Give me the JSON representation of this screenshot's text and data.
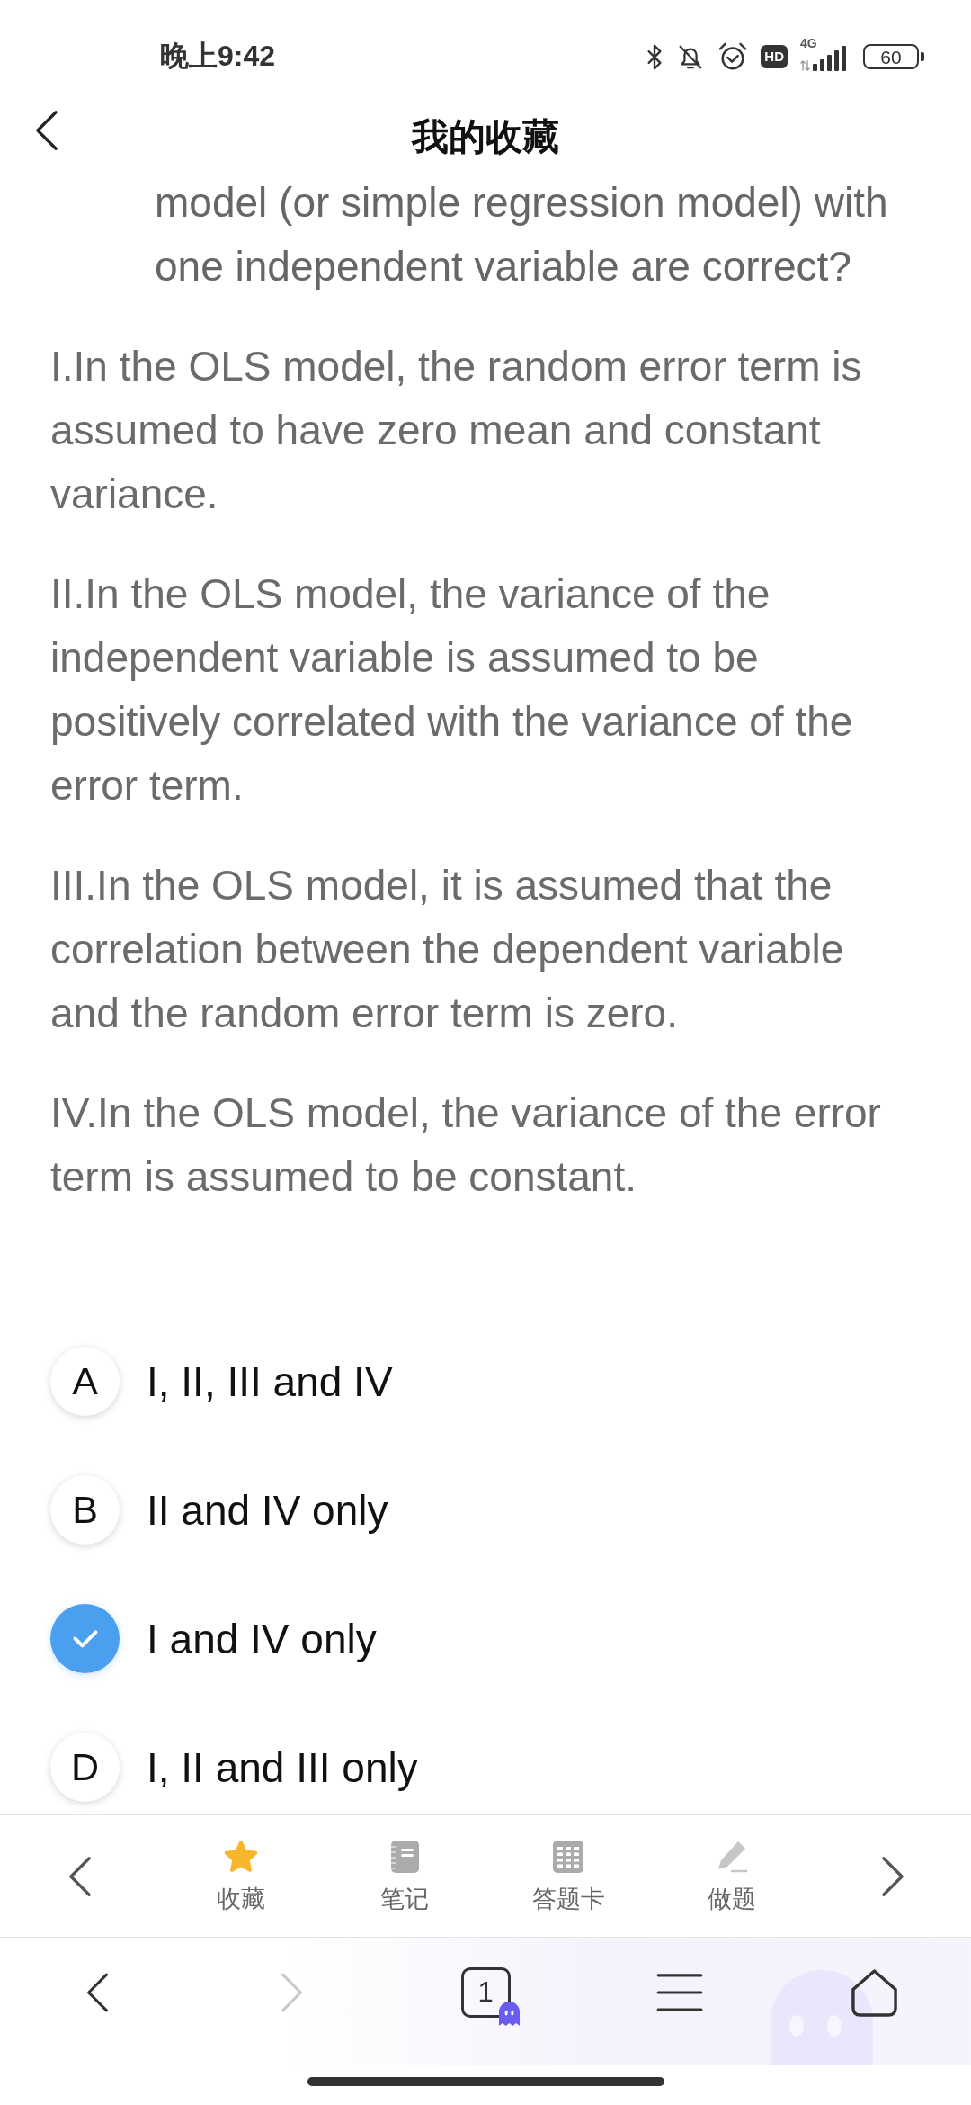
{
  "status_bar": {
    "time": "晚上9:42",
    "hd": "HD",
    "network": "4G",
    "battery": "60"
  },
  "header": {
    "title": "我的收藏"
  },
  "question": {
    "text": "model (or simple regression model) with one independent variable are correct?",
    "statements": [
      "I.In the OLS model, the random error term is assumed to have zero mean and constant variance.",
      "II.In the OLS model, the variance of the independent variable is assumed to be positively correlated with the variance of the error term.",
      "III.In the OLS model, it is assumed that the correlation between the dependent variable and the random error term is zero.",
      "IV.In the OLS model, the variance of the error term is assumed to be constant."
    ]
  },
  "options": [
    {
      "letter": "A",
      "text": "I, II, III and IV",
      "selected": false
    },
    {
      "letter": "B",
      "text": "II and IV only",
      "selected": false
    },
    {
      "text": "I and IV only",
      "selected": true
    },
    {
      "letter": "D",
      "text": "I, II and III only",
      "selected": false
    }
  ],
  "toolbar": {
    "items": [
      {
        "label": "收藏",
        "on": true
      },
      {
        "label": "笔记",
        "on": false
      },
      {
        "label": "答题卡",
        "on": false
      },
      {
        "label": "做题",
        "on": false
      }
    ]
  },
  "browser_bar": {
    "back": {
      "disabled": false
    },
    "forward": {
      "disabled": true
    },
    "tab_count": "1"
  }
}
